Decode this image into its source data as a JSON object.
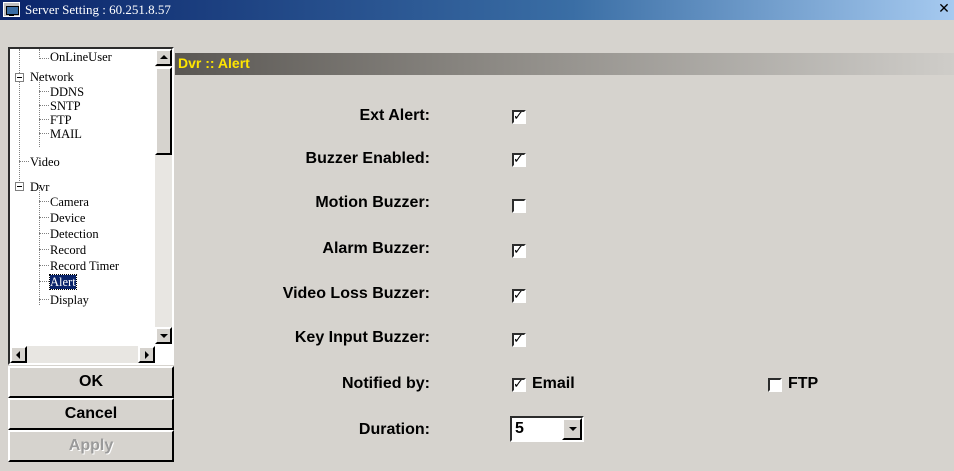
{
  "window": {
    "title": "Server Setting : 60.251.8.57"
  },
  "tree": {
    "items": [
      {
        "label": "OnLineUser",
        "level": 1
      },
      {
        "label": "Network",
        "level": 0,
        "expanded": true
      },
      {
        "label": "DDNS",
        "level": 1
      },
      {
        "label": "SNTP",
        "level": 1
      },
      {
        "label": "FTP",
        "level": 1
      },
      {
        "label": "MAIL",
        "level": 1
      },
      {
        "label": "Video",
        "level": 0
      },
      {
        "label": "Dvr",
        "level": 0,
        "expanded": true
      },
      {
        "label": "Camera",
        "level": 1
      },
      {
        "label": "Device",
        "level": 1
      },
      {
        "label": "Detection",
        "level": 1
      },
      {
        "label": "Record",
        "level": 1
      },
      {
        "label": "Record Timer",
        "level": 1
      },
      {
        "label": "Alert",
        "level": 1,
        "selected": true
      },
      {
        "label": "Display",
        "level": 1
      }
    ]
  },
  "buttons": {
    "ok": "OK",
    "cancel": "Cancel",
    "apply": "Apply"
  },
  "section": {
    "header": "Dvr :: Alert"
  },
  "fields": [
    {
      "label": "Ext Alert:",
      "checked": true
    },
    {
      "label": "Buzzer Enabled:",
      "checked": true
    },
    {
      "label": "Motion Buzzer:",
      "checked": false
    },
    {
      "label": "Alarm Buzzer:",
      "checked": true
    },
    {
      "label": "Video Loss Buzzer:",
      "checked": true
    },
    {
      "label": "Key Input Buzzer:",
      "checked": true
    }
  ],
  "notified": {
    "label": "Notified by:",
    "options": [
      {
        "label": "Email",
        "checked": true
      },
      {
        "label": "FTP",
        "checked": false
      }
    ]
  },
  "duration": {
    "label": "Duration:",
    "value": "5"
  },
  "colors": {
    "title_bar": "#0a246a",
    "header_text": "#ffe600",
    "background": "#d6d3ce"
  }
}
